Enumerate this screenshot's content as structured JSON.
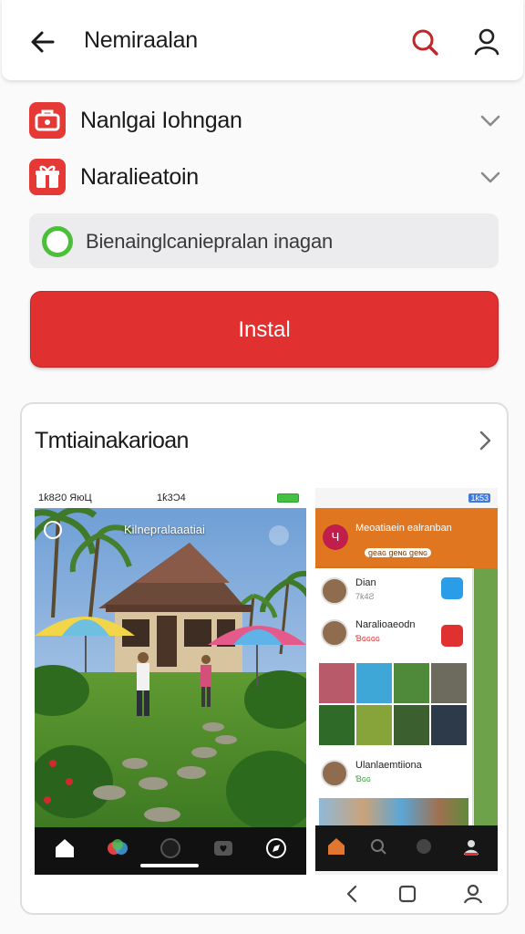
{
  "topbar": {
    "title": "Nemiraalan",
    "back_icon": "back-arrow-icon",
    "search_icon": "search-icon",
    "account_icon": "account-icon",
    "search_color": "#c0262a"
  },
  "rows": [
    {
      "label": "Nanlgai Iohngan",
      "icon": "briefcase-icon"
    },
    {
      "label": "Naralieatoin",
      "icon": "gift-box-icon"
    }
  ],
  "status": {
    "text": "Bienainglcaniepralan inagan",
    "dot_color": "#4cbf3a"
  },
  "install_button": {
    "label": "Instal",
    "color": "#e03030"
  },
  "card": {
    "title": "Tmtiainakarioan",
    "screenshot1": {
      "status_left": "1ƙ8Ƨ0 ЯюЦ",
      "status_time": "1ƙ3Ɔ4",
      "photo_label": "Kilnepralaaatiai"
    },
    "screenshot2": {
      "status_right": "1ƙ53",
      "header_title": "Meoatiaein ealranban",
      "header_chips": "ɡeaɢ ɡeɴɢ ɡeɴɢ",
      "avatar_letter": "Ч",
      "feed": [
        {
          "name": "Dian",
          "sub": "7ƙ4Ƨ"
        },
        {
          "name": "Naralioaeodn",
          "sub": "Ɓɢɢɢɢ"
        },
        {
          "name": "Ulanlaemtiiona",
          "sub": "Ɓɢɢ"
        }
      ]
    }
  }
}
